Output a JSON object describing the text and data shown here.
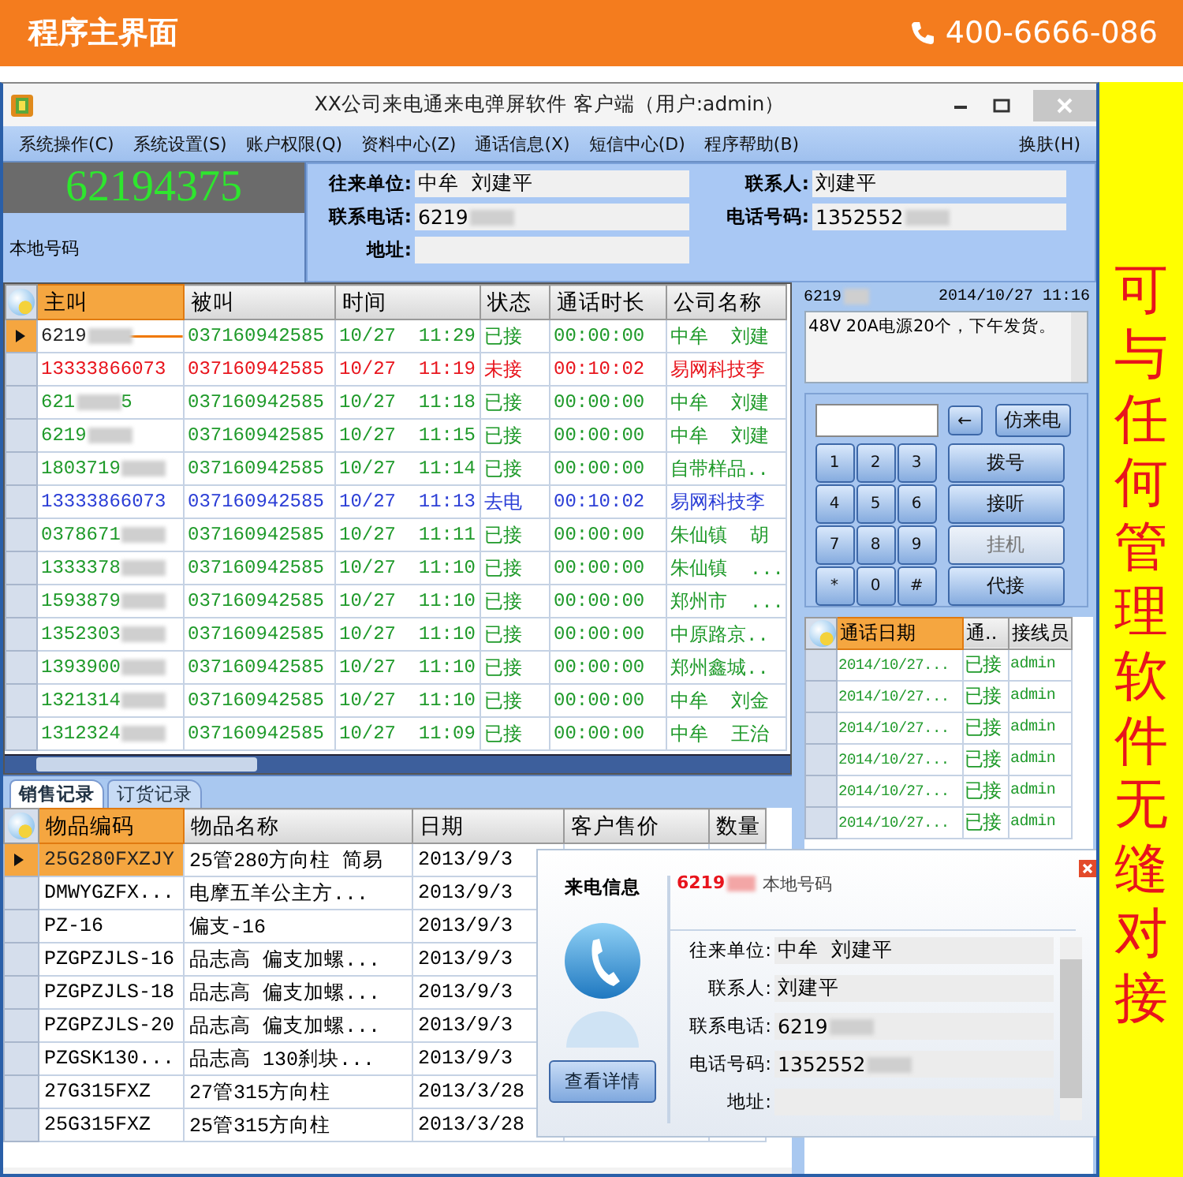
{
  "banner": {
    "title": "程序主界面",
    "phone": "400-6666-086"
  },
  "side_slogan": "可与任何管理软件无缝对接",
  "window": {
    "title": "XX公司来电通来电弹屏软件 客户端（用户:admin）"
  },
  "menu": [
    "系统操作(C)",
    "系统设置(S)",
    "账户权限(Q)",
    "资料中心(Z)",
    "通话信息(X)",
    "短信中心(D)",
    "程序帮助(B)"
  ],
  "menu_right": "换肤(H)",
  "caller_panel": {
    "number": "62194375",
    "label": "本地号码"
  },
  "contact": [
    {
      "label": "往来单位:",
      "value": "中牟  刘建平",
      "masked": false
    },
    {
      "label": "联系人:",
      "value": "刘建平",
      "masked": false
    },
    {
      "label": "联系电话:",
      "value": "6219",
      "masked": true
    },
    {
      "label": "电话号码:",
      "value": "1352552",
      "masked": true
    },
    {
      "label": "地址:",
      "masked": false
    }
  ],
  "calls": {
    "columns": [
      {
        "label": "主叫",
        "highlighted": true
      },
      {
        "label": "被叫",
        "highlighted": false
      },
      {
        "label": "时间",
        "highlighted": false
      },
      {
        "label": "状态",
        "highlighted": false
      },
      {
        "label": "通话时长",
        "highlighted": false
      },
      {
        "label": "公司名称",
        "highlighted": false
      }
    ],
    "rows": [
      {
        "caller": "6219",
        "masked": true,
        "callee": "037160942585",
        "time": "10/27  11:29",
        "status": "已接",
        "duration": "00:00:00",
        "company": "中牟  刘建",
        "kind": "answered",
        "selected": true
      },
      {
        "caller": "13333866073",
        "masked": false,
        "callee": "037160942585",
        "time": "10/27  11:19",
        "status": "未接",
        "duration": "00:10:02",
        "company": "易网科技李",
        "kind": "missed",
        "selected": false
      },
      {
        "caller": "621",
        "masked": true,
        "caller_tail": "5",
        "callee": "037160942585",
        "time": "10/27  11:18",
        "status": "已接",
        "duration": "00:00:00",
        "company": "中牟  刘建",
        "kind": "answered",
        "selected": false
      },
      {
        "caller": "6219",
        "masked": true,
        "callee": "037160942585",
        "time": "10/27  11:15",
        "status": "已接",
        "duration": "00:00:00",
        "company": "中牟  刘建",
        "kind": "answered",
        "selected": false
      },
      {
        "caller": "1803719",
        "masked": true,
        "callee": "037160942585",
        "time": "10/27  11:14",
        "status": "已接",
        "duration": "00:00:00",
        "company": "自带样品..",
        "kind": "answered",
        "selected": false
      },
      {
        "caller": "13333866073",
        "masked": false,
        "callee": "037160942585",
        "time": "10/27  11:13",
        "status": "去电",
        "duration": "00:10:02",
        "company": "易网科技李",
        "kind": "outgoing",
        "selected": false
      },
      {
        "caller": "0378671",
        "masked": true,
        "callee": "037160942585",
        "time": "10/27  11:11",
        "status": "已接",
        "duration": "00:00:00",
        "company": "朱仙镇  胡",
        "kind": "answered",
        "selected": false
      },
      {
        "caller": "1333378",
        "masked": true,
        "callee": "037160942585",
        "time": "10/27  11:10",
        "status": "已接",
        "duration": "00:00:00",
        "company": "朱仙镇  ...",
        "kind": "answered",
        "selected": false
      },
      {
        "caller": "1593879",
        "masked": true,
        "callee": "037160942585",
        "time": "10/27  11:10",
        "status": "已接",
        "duration": "00:00:00",
        "company": "郑州市  ...",
        "kind": "answered",
        "selected": false
      },
      {
        "caller": "1352303",
        "masked": true,
        "callee": "037160942585",
        "time": "10/27  11:10",
        "status": "已接",
        "duration": "00:00:00",
        "company": "中原路京..",
        "kind": "answered",
        "selected": false
      },
      {
        "caller": "1393900",
        "masked": true,
        "callee": "037160942585",
        "time": "10/27  11:10",
        "status": "已接",
        "duration": "00:00:00",
        "company": "郑州鑫城..",
        "kind": "answered",
        "selected": false
      },
      {
        "caller": "1321314",
        "masked": true,
        "callee": "037160942585",
        "time": "10/27  11:10",
        "status": "已接",
        "duration": "00:00:00",
        "company": "中牟  刘金",
        "kind": "answered",
        "selected": false
      },
      {
        "caller": "1312324",
        "masked": true,
        "callee": "037160942585",
        "time": "10/27  11:09",
        "status": "已接",
        "duration": "00:00:00",
        "company": "中牟  王治",
        "kind": "answered",
        "selected": false
      }
    ]
  },
  "message": {
    "from": "6219",
    "masked": true,
    "time": "2014/10/27 11:16",
    "text": "48V 20A电源20个，下午发货。"
  },
  "dialer": {
    "back": "←",
    "simulate": "仿来电",
    "keys": [
      "1",
      "2",
      "3",
      "4",
      "5",
      "6",
      "7",
      "8",
      "9",
      "*",
      "0",
      "#"
    ],
    "actions": [
      {
        "label": "拨号",
        "disabled": false
      },
      {
        "label": "接听",
        "disabled": false
      },
      {
        "label": "挂机",
        "disabled": true
      },
      {
        "label": "代接",
        "disabled": false
      }
    ]
  },
  "history": {
    "columns": [
      {
        "label": "通话日期",
        "highlighted": true
      },
      {
        "label": "通..",
        "highlighted": false
      },
      {
        "label": "接线员",
        "highlighted": false
      }
    ],
    "rows": [
      {
        "date": "2014/10/27...",
        "status": "已接",
        "agent": "admin"
      },
      {
        "date": "2014/10/27...",
        "status": "已接",
        "agent": "admin"
      },
      {
        "date": "2014/10/27...",
        "status": "已接",
        "agent": "admin"
      },
      {
        "date": "2014/10/27...",
        "status": "已接",
        "agent": "admin"
      },
      {
        "date": "2014/10/27...",
        "status": "已接",
        "agent": "admin"
      },
      {
        "date": "2014/10/27...",
        "status": "已接",
        "agent": "admin"
      }
    ]
  },
  "record_tabs": [
    {
      "label": "销售记录",
      "selected": true
    },
    {
      "label": "订货记录",
      "selected": false
    }
  ],
  "sales": {
    "columns": [
      {
        "label": "物品编码",
        "highlighted": true
      },
      {
        "label": "物品名称",
        "highlighted": false
      },
      {
        "label": "日期",
        "highlighted": false
      },
      {
        "label": "客户售价",
        "highlighted": false
      },
      {
        "label": "数量",
        "highlighted": false
      }
    ],
    "rows": [
      {
        "code": "25G280FXZJY",
        "name": "25管280方向柱 简易",
        "date": "2013/9/3",
        "selected": true
      },
      {
        "code": "DMWYGZFX...",
        "name": "电摩五羊公主方...",
        "date": "2013/9/3",
        "selected": false
      },
      {
        "code": "PZ-16",
        "name": "偏支-16",
        "date": "2013/9/3",
        "selected": false
      },
      {
        "code": "PZGPZJLS-16",
        "name": "品志高 偏支加螺...",
        "date": "2013/9/3",
        "selected": false
      },
      {
        "code": "PZGPZJLS-18",
        "name": "品志高 偏支加螺...",
        "date": "2013/9/3",
        "selected": false
      },
      {
        "code": "PZGPZJLS-20",
        "name": "品志高 偏支加螺...",
        "date": "2013/9/3",
        "selected": false
      },
      {
        "code": "PZGSK130...",
        "name": "品志高 130刹块...",
        "date": "2013/9/3",
        "selected": false
      },
      {
        "code": "27G315FXZ",
        "name": "27管315方向柱",
        "date": "2013/3/28",
        "selected": false
      },
      {
        "code": "25G315FXZ",
        "name": "25管315方向柱",
        "date": "2013/3/28",
        "selected": false
      }
    ]
  },
  "popup": {
    "title": "来电信息",
    "number": "6219",
    "masked": true,
    "label": "本地号码",
    "details_button": "查看详情",
    "fields": [
      {
        "label": "往来单位:",
        "value": "中牟  刘建平",
        "masked": false
      },
      {
        "label": "联系人:",
        "value": "刘建平",
        "masked": false
      },
      {
        "label": "联系电话:",
        "value": "6219",
        "masked": true
      },
      {
        "label": "电话号码:",
        "value": "1352552",
        "masked": true
      },
      {
        "label": "地址:",
        "masked": false
      }
    ]
  }
}
